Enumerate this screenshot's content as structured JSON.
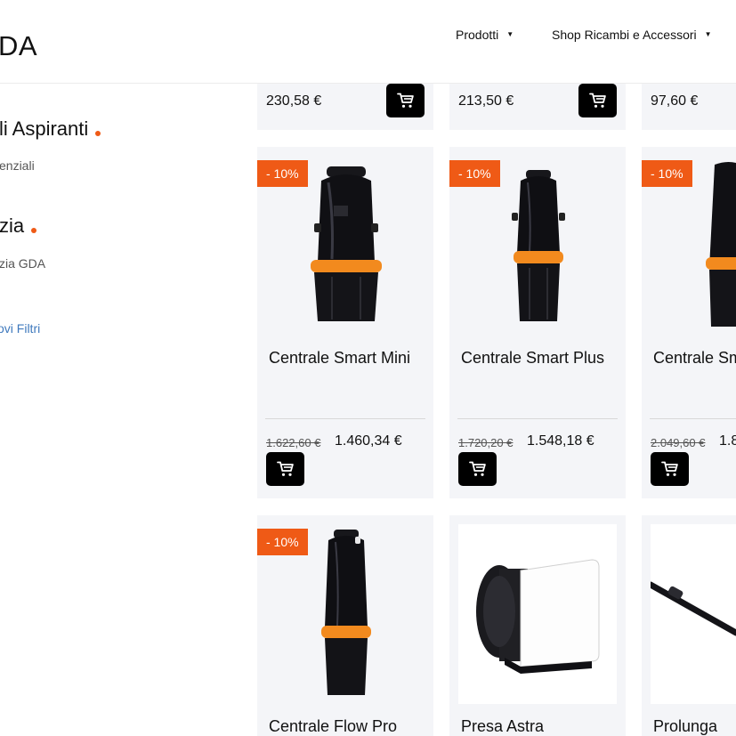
{
  "header": {
    "logo_text": "DA",
    "nav": [
      {
        "label": "Prodotti"
      },
      {
        "label": "Shop Ricambi e Accessori"
      }
    ]
  },
  "sidebar": {
    "section1_title": "li Aspiranti",
    "section1_sub": "enziali",
    "section2_title": "zia",
    "section2_sub": "zia GDA",
    "reset_link": "ovi Filtri"
  },
  "products_top": [
    {
      "price": "230,58 €"
    },
    {
      "price": "213,50 €"
    },
    {
      "price": "97,60 €"
    }
  ],
  "products": [
    {
      "badge": "- 10%",
      "name": "Centrale Smart Mini",
      "old_price": "1.622,60 €",
      "price": "1.460,34 €"
    },
    {
      "badge": "- 10%",
      "name": "Centrale Smart Plus",
      "old_price": "1.720,20 €",
      "price": "1.548,18 €"
    },
    {
      "badge": "- 10%",
      "name": "Centrale Sm",
      "old_price": "2.049,60 €",
      "price": "1.8"
    },
    {
      "badge": "- 10%",
      "name": "Centrale Flow Pro"
    },
    {
      "name": "Presa Astra"
    },
    {
      "name": "Prolunga"
    }
  ],
  "icons": {
    "cart": "cart-icon",
    "caret": "caret-down-icon"
  },
  "colors": {
    "accent": "#ef5a16",
    "card_bg": "#f4f5f8",
    "button": "#000000",
    "link": "#3f79bd"
  }
}
